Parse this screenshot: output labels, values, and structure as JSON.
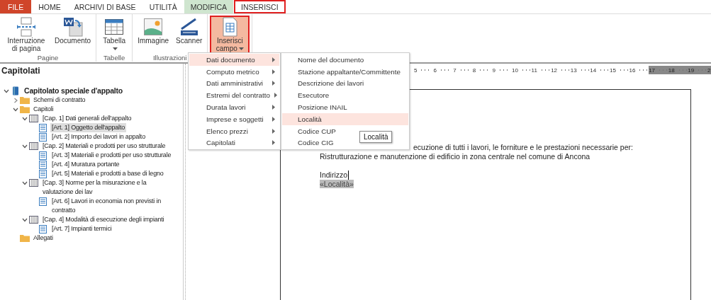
{
  "ribbon": {
    "tabs": [
      {
        "label": "FILE",
        "kind": "file",
        "selected": false
      },
      {
        "label": "HOME",
        "kind": "normal",
        "selected": false
      },
      {
        "label": "ARCHIVI DI BASE",
        "kind": "normal",
        "selected": false
      },
      {
        "label": "UTILITÀ",
        "kind": "normal",
        "selected": false
      },
      {
        "label": "MODIFICA",
        "kind": "context",
        "selected": false
      },
      {
        "label": "INSERISCI",
        "kind": "normal",
        "selected": true
      }
    ],
    "groups": [
      {
        "label": "Pagine",
        "buttons": [
          {
            "label": "Interruzione di pagina",
            "dropdown": false,
            "pressed": false
          },
          {
            "label": "Documento",
            "dropdown": false,
            "pressed": false
          }
        ]
      },
      {
        "label": "Tabelle",
        "buttons": [
          {
            "label": "Tabella",
            "dropdown": true,
            "pressed": false
          }
        ]
      },
      {
        "label": "Illustrazioni",
        "buttons": [
          {
            "label": "Immagine",
            "dropdown": false,
            "pressed": false
          },
          {
            "label": "Scanner",
            "dropdown": false,
            "pressed": false
          }
        ]
      },
      {
        "buttons": [
          {
            "label": "Inserisci campo",
            "dropdown": true,
            "pressed": true
          }
        ]
      }
    ]
  },
  "sidebar": {
    "title": "Capitolati",
    "tree": [
      {
        "label": "Capitolato speciale d'appalto",
        "kind": "book",
        "expanded": true,
        "selected": false,
        "children": [
          {
            "label": "Schemi di contratto",
            "kind": "folder",
            "expanded": false,
            "selected": false
          },
          {
            "label": "Capitoli",
            "kind": "folder",
            "expanded": true,
            "selected": false,
            "children": [
              {
                "label": "[Cap. 1] Dati generali dell'appalto",
                "kind": "chapter",
                "expanded": true,
                "selected": false,
                "children": [
                  {
                    "label": "[Art. 1] Oggetto dell'appalto",
                    "kind": "article",
                    "selected": true
                  },
                  {
                    "label": "[Art. 2] Importo dei lavori in appalto",
                    "kind": "article",
                    "selected": false
                  }
                ]
              },
              {
                "label": "[Cap. 2] Materiali e prodotti per uso strutturale",
                "kind": "chapter",
                "expanded": true,
                "selected": false,
                "children": [
                  {
                    "label": "[Art. 3] Materiali e prodotti per uso strutturale",
                    "kind": "article",
                    "selected": false
                  },
                  {
                    "label": "[Art. 4] Muratura portante",
                    "kind": "article",
                    "selected": false
                  },
                  {
                    "label": "[Art. 5] Materiali e prodotti a base di legno",
                    "kind": "article",
                    "selected": false
                  }
                ]
              },
              {
                "label": "[Cap. 3] Norme per la misurazione e la valutazione dei lav",
                "kind": "chapter",
                "expanded": true,
                "selected": false,
                "children": [
                  {
                    "label": "[Art. 6] Lavori in economia non previsti in contratto",
                    "kind": "article",
                    "selected": false
                  }
                ]
              },
              {
                "label": "[Cap. 4] Modalità di esecuzione degli impianti",
                "kind": "chapter",
                "expanded": true,
                "selected": false,
                "children": [
                  {
                    "label": "[Art. 7] Impianti termici",
                    "kind": "article",
                    "selected": false
                  }
                ]
              }
            ]
          },
          {
            "label": "Allegati",
            "kind": "folder",
            "selected": false
          }
        ]
      }
    ]
  },
  "ruler": [
    {
      "label": "5",
      "kind": "page"
    },
    {
      "label": "6",
      "kind": "page"
    },
    {
      "label": "7",
      "kind": "page"
    },
    {
      "label": "8",
      "kind": "page"
    },
    {
      "label": "9",
      "kind": "page"
    },
    {
      "label": "10",
      "kind": "page"
    },
    {
      "label": "11",
      "kind": "page"
    },
    {
      "label": "12",
      "kind": "page"
    },
    {
      "label": "13",
      "kind": "page"
    },
    {
      "label": "14",
      "kind": "page"
    },
    {
      "label": "15",
      "kind": "page"
    },
    {
      "label": "16",
      "kind": "page"
    },
    {
      "label": "17",
      "kind": "margin"
    },
    {
      "label": "18",
      "kind": "margin"
    },
    {
      "label": "19",
      "kind": "margin"
    },
    {
      "label": "2",
      "kind": "margin"
    }
  ],
  "document": {
    "lines": [
      {
        "text": "ecuzione di tutti i lavori, le forniture e le prestazioni necessarie per:",
        "kind": "partial"
      },
      {
        "text": "Ristrutturazione e manutenzione di edificio in zona centrale nel comune di Ancona",
        "kind": "text"
      },
      {
        "text": "Indirizzo",
        "kind": "cursor"
      },
      {
        "text": "«Località»",
        "kind": "field"
      }
    ]
  },
  "menu": {
    "items": [
      {
        "label": "Dati documento",
        "selected": true
      },
      {
        "label": "Computo metrico",
        "selected": false
      },
      {
        "label": "Dati amministrativi",
        "selected": false
      },
      {
        "label": "Estremi del contratto",
        "selected": false
      },
      {
        "label": "Durata lavori",
        "selected": false
      },
      {
        "label": "Imprese e soggetti",
        "selected": false
      },
      {
        "label": "Elenco prezzi",
        "selected": false
      },
      {
        "label": "Capitolati",
        "selected": false
      }
    ],
    "submenu": [
      {
        "label": "Nome del documento",
        "selected": false
      },
      {
        "label": "Stazione appaltante/Committente",
        "selected": false
      },
      {
        "label": "Descrizione dei lavori",
        "selected": false
      },
      {
        "label": "Esecutore",
        "selected": false
      },
      {
        "label": "Posizione INAIL",
        "selected": false
      },
      {
        "label": "Località",
        "selected": true
      },
      {
        "label": "Codice CUP",
        "selected": false
      },
      {
        "label": "Codice CIG",
        "selected": false
      }
    ],
    "tooltip": "Località"
  }
}
